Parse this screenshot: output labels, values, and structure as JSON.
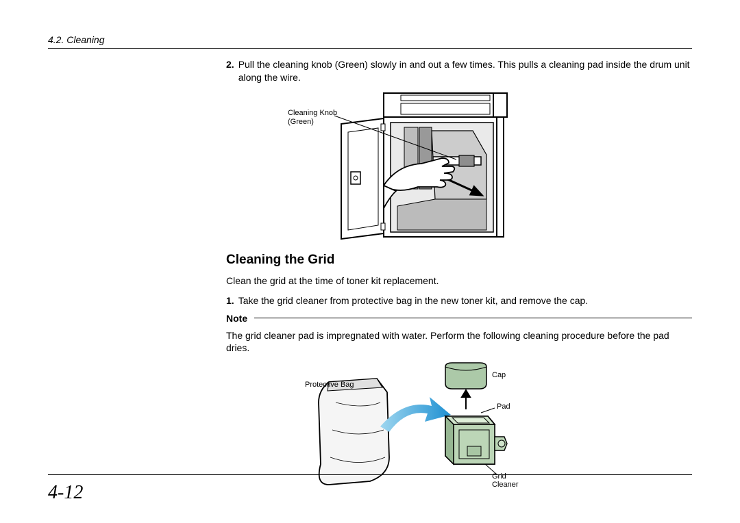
{
  "header": {
    "section": "4.2.  Cleaning"
  },
  "step2": {
    "num": "2.",
    "text": "Pull the cleaning knob (Green) slowly in and out a few times. This pulls a cleaning pad inside the drum unit along the wire."
  },
  "figure1": {
    "label_line1": "Cleaning Knob",
    "label_line2": "(Green)"
  },
  "heading": "Cleaning the Grid",
  "intro": "Clean the grid at the time of toner kit replacement.",
  "step1": {
    "num": "1.",
    "text": "Take the grid cleaner from protective bag in the new toner kit, and remove the cap."
  },
  "note": {
    "label": "Note",
    "text": "The grid cleaner pad is impregnated with water. Perform the following cleaning procedure before the pad dries."
  },
  "figure2": {
    "protective_bag": "Protective Bag",
    "cap": "Cap",
    "pad": "Pad",
    "grid_cleaner": "Grid Cleaner"
  },
  "page_number": "4-12"
}
